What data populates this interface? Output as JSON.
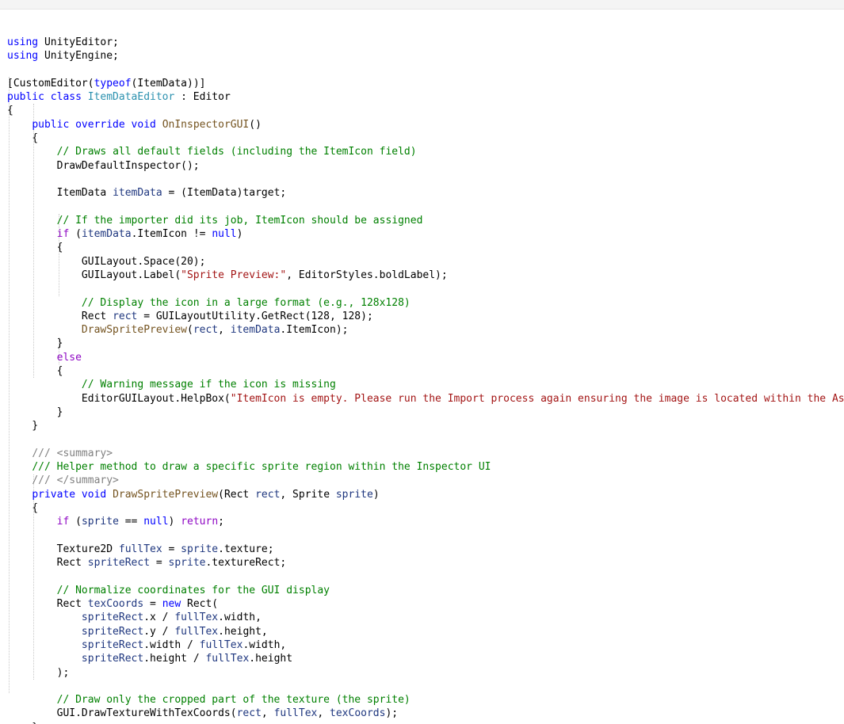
{
  "editor": {
    "language": "C#",
    "lines": [
      [
        [
          "kw",
          "using"
        ],
        [
          "plain",
          " UnityEditor;"
        ]
      ],
      [
        [
          "kw",
          "using"
        ],
        [
          "plain",
          " UnityEngine;"
        ]
      ],
      [],
      [
        [
          "plain",
          "[CustomEditor("
        ],
        [
          "kw",
          "typeof"
        ],
        [
          "plain",
          "(ItemData))]"
        ]
      ],
      [
        [
          "kw",
          "public class"
        ],
        [
          "plain",
          " "
        ],
        [
          "type",
          "ItemDataEditor"
        ],
        [
          "plain",
          " : Editor"
        ]
      ],
      [
        [
          "plain",
          "{"
        ]
      ],
      [
        [
          "plain",
          "    "
        ],
        [
          "kw",
          "public override void"
        ],
        [
          "plain",
          " "
        ],
        [
          "method",
          "OnInspectorGUI"
        ],
        [
          "plain",
          "()"
        ]
      ],
      [
        [
          "plain",
          "    {"
        ]
      ],
      [
        [
          "plain",
          "        "
        ],
        [
          "cmt",
          "// Draws all default fields (including the ItemIcon field)"
        ]
      ],
      [
        [
          "plain",
          "        DrawDefaultInspector();"
        ]
      ],
      [],
      [
        [
          "plain",
          "        ItemData "
        ],
        [
          "local",
          "itemData"
        ],
        [
          "plain",
          " = (ItemData)target;"
        ]
      ],
      [],
      [
        [
          "plain",
          "        "
        ],
        [
          "cmt",
          "// If the importer did its job, ItemIcon should be assigned"
        ]
      ],
      [
        [
          "plain",
          "        "
        ],
        [
          "ctl",
          "if"
        ],
        [
          "plain",
          " ("
        ],
        [
          "local",
          "itemData"
        ],
        [
          "plain",
          ".ItemIcon != "
        ],
        [
          "kw",
          "null"
        ],
        [
          "plain",
          ")"
        ]
      ],
      [
        [
          "plain",
          "        {"
        ]
      ],
      [
        [
          "plain",
          "            GUILayout.Space(20);"
        ]
      ],
      [
        [
          "plain",
          "            GUILayout.Label("
        ],
        [
          "str",
          "\"Sprite Preview:\""
        ],
        [
          "plain",
          ", EditorStyles.boldLabel);"
        ]
      ],
      [],
      [
        [
          "plain",
          "            "
        ],
        [
          "cmt",
          "// Display the icon in a large format (e.g., 128x128)"
        ]
      ],
      [
        [
          "plain",
          "            Rect "
        ],
        [
          "local",
          "rect"
        ],
        [
          "plain",
          " = GUILayoutUtility.GetRect(128, 128);"
        ]
      ],
      [
        [
          "plain",
          "            "
        ],
        [
          "method",
          "DrawSpritePreview"
        ],
        [
          "plain",
          "("
        ],
        [
          "local",
          "rect"
        ],
        [
          "plain",
          ", "
        ],
        [
          "local",
          "itemData"
        ],
        [
          "plain",
          ".ItemIcon);"
        ]
      ],
      [
        [
          "plain",
          "        }"
        ]
      ],
      [
        [
          "plain",
          "        "
        ],
        [
          "ctl",
          "else"
        ]
      ],
      [
        [
          "plain",
          "        {"
        ]
      ],
      [
        [
          "plain",
          "            "
        ],
        [
          "cmt",
          "// Warning message if the icon is missing"
        ]
      ],
      [
        [
          "plain",
          "            EditorGUILayout.HelpBox("
        ],
        [
          "str",
          "\"ItemIcon is empty. Please run the Import process again ensuring the image is located within the Asse"
        ]
      ],
      [
        [
          "plain",
          "        }"
        ]
      ],
      [
        [
          "plain",
          "    }"
        ]
      ],
      [],
      [
        [
          "plain",
          "    "
        ],
        [
          "xml",
          "/// <summary>"
        ]
      ],
      [
        [
          "plain",
          "    "
        ],
        [
          "cmt",
          "/// Helper method to draw a specific sprite region within the Inspector UI"
        ]
      ],
      [
        [
          "plain",
          "    "
        ],
        [
          "xml",
          "/// </summary>"
        ]
      ],
      [
        [
          "plain",
          "    "
        ],
        [
          "kw",
          "private void"
        ],
        [
          "plain",
          " "
        ],
        [
          "method",
          "DrawSpritePreview"
        ],
        [
          "plain",
          "(Rect "
        ],
        [
          "local",
          "rect"
        ],
        [
          "plain",
          ", Sprite "
        ],
        [
          "local",
          "sprite"
        ],
        [
          "plain",
          ")"
        ]
      ],
      [
        [
          "plain",
          "    {"
        ]
      ],
      [
        [
          "plain",
          "        "
        ],
        [
          "ctl",
          "if"
        ],
        [
          "plain",
          " ("
        ],
        [
          "local",
          "sprite"
        ],
        [
          "plain",
          " == "
        ],
        [
          "kw",
          "null"
        ],
        [
          "plain",
          ") "
        ],
        [
          "ctl",
          "return"
        ],
        [
          "plain",
          ";"
        ]
      ],
      [],
      [
        [
          "plain",
          "        Texture2D "
        ],
        [
          "local",
          "fullTex"
        ],
        [
          "plain",
          " = "
        ],
        [
          "local",
          "sprite"
        ],
        [
          "plain",
          ".texture;"
        ]
      ],
      [
        [
          "plain",
          "        Rect "
        ],
        [
          "local",
          "spriteRect"
        ],
        [
          "plain",
          " = "
        ],
        [
          "local",
          "sprite"
        ],
        [
          "plain",
          ".textureRect;"
        ]
      ],
      [],
      [
        [
          "plain",
          "        "
        ],
        [
          "cmt",
          "// Normalize coordinates for the GUI display"
        ]
      ],
      [
        [
          "plain",
          "        Rect "
        ],
        [
          "local",
          "texCoords"
        ],
        [
          "plain",
          " = "
        ],
        [
          "kw",
          "new"
        ],
        [
          "plain",
          " Rect("
        ]
      ],
      [
        [
          "plain",
          "            "
        ],
        [
          "local",
          "spriteRect"
        ],
        [
          "plain",
          ".x / "
        ],
        [
          "local",
          "fullTex"
        ],
        [
          "plain",
          ".width,"
        ]
      ],
      [
        [
          "plain",
          "            "
        ],
        [
          "local",
          "spriteRect"
        ],
        [
          "plain",
          ".y / "
        ],
        [
          "local",
          "fullTex"
        ],
        [
          "plain",
          ".height,"
        ]
      ],
      [
        [
          "plain",
          "            "
        ],
        [
          "local",
          "spriteRect"
        ],
        [
          "plain",
          ".width / "
        ],
        [
          "local",
          "fullTex"
        ],
        [
          "plain",
          ".width,"
        ]
      ],
      [
        [
          "plain",
          "            "
        ],
        [
          "local",
          "spriteRect"
        ],
        [
          "plain",
          ".height / "
        ],
        [
          "local",
          "fullTex"
        ],
        [
          "plain",
          ".height"
        ]
      ],
      [
        [
          "plain",
          "        );"
        ]
      ],
      [],
      [
        [
          "plain",
          "        "
        ],
        [
          "cmt",
          "// Draw only the cropped part of the texture (the sprite)"
        ]
      ],
      [
        [
          "plain",
          "        GUI.DrawTextureWithTexCoords("
        ],
        [
          "local",
          "rect"
        ],
        [
          "plain",
          ", "
        ],
        [
          "local",
          "fullTex"
        ],
        [
          "plain",
          ", "
        ],
        [
          "local",
          "texCoords"
        ],
        [
          "plain",
          ");"
        ]
      ],
      [
        [
          "plain",
          "    }"
        ]
      ],
      [
        [
          "plain",
          "}"
        ]
      ]
    ]
  }
}
